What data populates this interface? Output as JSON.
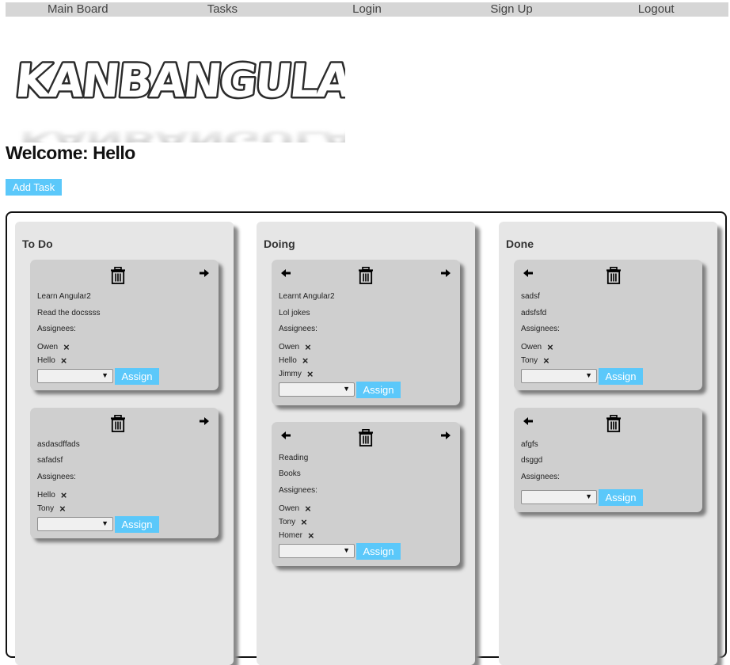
{
  "nav": {
    "items": [
      {
        "label": "Main Board"
      },
      {
        "label": "Tasks"
      },
      {
        "label": "Login"
      },
      {
        "label": "Sign Up"
      },
      {
        "label": "Logout"
      }
    ]
  },
  "logo": {
    "text": "KANBANGULAR"
  },
  "welcome": "Welcome: Hello",
  "add_task_label": "Add Task",
  "assign_label": "Assign",
  "assignees_label": "Assignees:",
  "columns": [
    {
      "title": "To Do",
      "cards": [
        {
          "title": "Learn Angular2",
          "description": "Read the docssss",
          "assignees": [
            "Owen",
            "Hello"
          ],
          "select_value": ""
        },
        {
          "title": "asdasdffads",
          "description": "safadsf",
          "assignees": [
            "Hello",
            "Tony"
          ],
          "select_value": ""
        }
      ]
    },
    {
      "title": "Doing",
      "cards": [
        {
          "title": "Learnt Angular2",
          "description": "Lol jokes",
          "assignees": [
            "Owen",
            "Hello",
            "Jimmy"
          ],
          "select_value": ""
        },
        {
          "title": "Reading",
          "description": "Books",
          "assignees": [
            "Owen",
            "Tony",
            "Homer"
          ],
          "select_value": ""
        }
      ]
    },
    {
      "title": "Done",
      "cards": [
        {
          "title": "sadsf",
          "description": "adsfsfd",
          "assignees": [
            "Owen",
            "Tony"
          ],
          "select_value": ""
        },
        {
          "title": "afgfs",
          "description": "dsggd",
          "assignees": [],
          "select_value": ""
        }
      ]
    }
  ]
}
